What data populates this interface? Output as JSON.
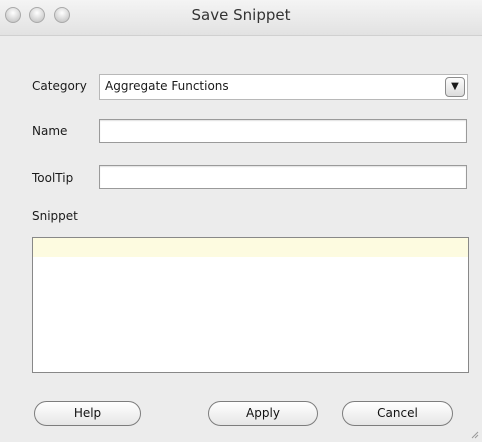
{
  "window": {
    "title": "Save Snippet"
  },
  "form": {
    "category_label": "Category",
    "category_value": "Aggregate Functions",
    "name_label": "Name",
    "name_value": "",
    "tooltip_label": "ToolTip",
    "tooltip_value": "",
    "snippet_label": "Snippet",
    "snippet_value": ""
  },
  "buttons": {
    "help": "Help",
    "apply": "Apply",
    "cancel": "Cancel"
  },
  "icons": {
    "dropdown": "chevron-down-icon",
    "close": "close-window-icon",
    "minimize": "minimize-window-icon",
    "zoom": "zoom-window-icon",
    "resize": "resize-grip-icon"
  }
}
